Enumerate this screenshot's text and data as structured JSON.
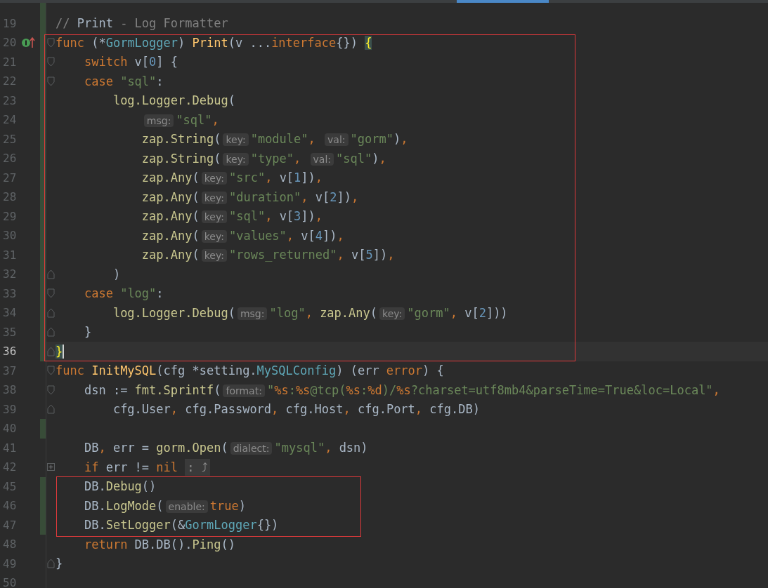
{
  "editor": {
    "lines": [
      {
        "changed": true
      },
      {
        "number": "19",
        "changed": true,
        "tokens": [
          {
            "kind": "comment",
            "text": "// "
          },
          {
            "kind": "comment_word",
            "text": "Print"
          },
          {
            "kind": "comment",
            "text": " - Log Formatter"
          }
        ]
      },
      {
        "number": "20",
        "changed": true,
        "boxed": true,
        "marker": true,
        "fold_start": true,
        "tokens": [
          {
            "kind": "keyword",
            "text": "func"
          },
          {
            "kind": "plain",
            "text": " (*"
          },
          {
            "kind": "type",
            "text": "GormLogger"
          },
          {
            "kind": "plain",
            "text": ") "
          },
          {
            "kind": "decl",
            "text": "Print"
          },
          {
            "kind": "plain",
            "text": "(v ..."
          },
          {
            "kind": "keyword",
            "text": "interface"
          },
          {
            "kind": "plain",
            "text": "{}) "
          },
          {
            "kind": "brace",
            "text": "{"
          }
        ]
      },
      {
        "number": "21",
        "changed": true,
        "boxed": true,
        "fold_start": true,
        "tokens": [
          {
            "kind": "keyword",
            "text": "    switch"
          },
          {
            "kind": "plain",
            "text": " v["
          },
          {
            "kind": "number",
            "text": "0"
          },
          {
            "kind": "plain",
            "text": "] {"
          }
        ]
      },
      {
        "number": "22",
        "changed": true,
        "boxed": true,
        "fold_start": true,
        "tokens": [
          {
            "kind": "keyword",
            "text": "    case"
          },
          {
            "kind": "string",
            "text": " \"sql\""
          },
          {
            "kind": "plain",
            "text": ":"
          }
        ]
      },
      {
        "number": "23",
        "changed": true,
        "boxed": true,
        "tokens": [
          {
            "kind": "call",
            "text": "        log.Logger.Debug"
          },
          {
            "kind": "plain",
            "text": "("
          }
        ]
      },
      {
        "number": "24",
        "changed": true,
        "boxed": true,
        "tokens": [
          {
            "kind": "hint",
            "text": "            msg:"
          },
          {
            "kind": "string",
            "text": "\"sql\""
          },
          {
            "kind": "keyword",
            "text": ","
          }
        ]
      },
      {
        "number": "25",
        "changed": true,
        "boxed": true,
        "tokens": [
          {
            "kind": "call",
            "text": "            zap.String"
          },
          {
            "kind": "plain",
            "text": "("
          },
          {
            "kind": "hint",
            "text": "key:"
          },
          {
            "kind": "string",
            "text": "\"module\""
          },
          {
            "kind": "keyword",
            "text": ", "
          },
          {
            "kind": "hint",
            "text": "val:"
          },
          {
            "kind": "string",
            "text": "\"gorm\""
          },
          {
            "kind": "plain",
            "text": ")"
          },
          {
            "kind": "keyword",
            "text": ","
          }
        ]
      },
      {
        "number": "26",
        "changed": true,
        "boxed": true,
        "tokens": [
          {
            "kind": "call",
            "text": "            zap.String"
          },
          {
            "kind": "plain",
            "text": "("
          },
          {
            "kind": "hint",
            "text": "key:"
          },
          {
            "kind": "string",
            "text": "\"type\""
          },
          {
            "kind": "keyword",
            "text": ", "
          },
          {
            "kind": "hint",
            "text": "val:"
          },
          {
            "kind": "string",
            "text": "\"sql\""
          },
          {
            "kind": "plain",
            "text": ")"
          },
          {
            "kind": "keyword",
            "text": ","
          }
        ]
      },
      {
        "number": "27",
        "changed": true,
        "boxed": true,
        "tokens": [
          {
            "kind": "call",
            "text": "            zap.Any"
          },
          {
            "kind": "plain",
            "text": "("
          },
          {
            "kind": "hint",
            "text": "key:"
          },
          {
            "kind": "string",
            "text": "\"src\""
          },
          {
            "kind": "keyword",
            "text": ","
          },
          {
            "kind": "plain",
            "text": " v["
          },
          {
            "kind": "number",
            "text": "1"
          },
          {
            "kind": "plain",
            "text": "])"
          },
          {
            "kind": "keyword",
            "text": ","
          }
        ]
      },
      {
        "number": "28",
        "changed": true,
        "boxed": true,
        "tokens": [
          {
            "kind": "call",
            "text": "            zap.Any"
          },
          {
            "kind": "plain",
            "text": "("
          },
          {
            "kind": "hint",
            "text": "key:"
          },
          {
            "kind": "string",
            "text": "\"duration\""
          },
          {
            "kind": "keyword",
            "text": ","
          },
          {
            "kind": "plain",
            "text": " v["
          },
          {
            "kind": "number",
            "text": "2"
          },
          {
            "kind": "plain",
            "text": "])"
          },
          {
            "kind": "keyword",
            "text": ","
          }
        ]
      },
      {
        "number": "29",
        "changed": true,
        "boxed": true,
        "tokens": [
          {
            "kind": "call",
            "text": "            zap.Any"
          },
          {
            "kind": "plain",
            "text": "("
          },
          {
            "kind": "hint",
            "text": "key:"
          },
          {
            "kind": "string",
            "text": "\"sql\""
          },
          {
            "kind": "keyword",
            "text": ","
          },
          {
            "kind": "plain",
            "text": " v["
          },
          {
            "kind": "number",
            "text": "3"
          },
          {
            "kind": "plain",
            "text": "])"
          },
          {
            "kind": "keyword",
            "text": ","
          }
        ]
      },
      {
        "number": "30",
        "changed": true,
        "boxed": true,
        "tokens": [
          {
            "kind": "call",
            "text": "            zap.Any"
          },
          {
            "kind": "plain",
            "text": "("
          },
          {
            "kind": "hint",
            "text": "key:"
          },
          {
            "kind": "string",
            "text": "\"values\""
          },
          {
            "kind": "keyword",
            "text": ","
          },
          {
            "kind": "plain",
            "text": " v["
          },
          {
            "kind": "number",
            "text": "4"
          },
          {
            "kind": "plain",
            "text": "])"
          },
          {
            "kind": "keyword",
            "text": ","
          }
        ]
      },
      {
        "number": "31",
        "changed": true,
        "boxed": true,
        "tokens": [
          {
            "kind": "call",
            "text": "            zap.Any"
          },
          {
            "kind": "plain",
            "text": "("
          },
          {
            "kind": "hint",
            "text": "key:"
          },
          {
            "kind": "string",
            "text": "\"rows_returned\""
          },
          {
            "kind": "keyword",
            "text": ","
          },
          {
            "kind": "plain",
            "text": " v["
          },
          {
            "kind": "number",
            "text": "5"
          },
          {
            "kind": "plain",
            "text": "])"
          },
          {
            "kind": "keyword",
            "text": ","
          }
        ]
      },
      {
        "number": "32",
        "changed": true,
        "boxed": true,
        "fold_end": true,
        "tokens": [
          {
            "kind": "plain",
            "text": "        )"
          }
        ]
      },
      {
        "number": "33",
        "changed": true,
        "boxed": true,
        "fold_start": true,
        "tokens": [
          {
            "kind": "keyword",
            "text": "    case"
          },
          {
            "kind": "string",
            "text": " \"log\""
          },
          {
            "kind": "plain",
            "text": ":"
          }
        ]
      },
      {
        "number": "34",
        "changed": true,
        "boxed": true,
        "fold_end": true,
        "tokens": [
          {
            "kind": "call",
            "text": "        log.Logger.Debug"
          },
          {
            "kind": "plain",
            "text": "("
          },
          {
            "kind": "hint",
            "text": "msg:"
          },
          {
            "kind": "string",
            "text": "\"log\""
          },
          {
            "kind": "keyword",
            "text": ","
          },
          {
            "kind": "call",
            "text": " zap.Any"
          },
          {
            "kind": "plain",
            "text": "("
          },
          {
            "kind": "hint",
            "text": "key:"
          },
          {
            "kind": "string",
            "text": "\"gorm\""
          },
          {
            "kind": "keyword",
            "text": ","
          },
          {
            "kind": "plain",
            "text": " v["
          },
          {
            "kind": "number",
            "text": "2"
          },
          {
            "kind": "plain",
            "text": "]))"
          }
        ]
      },
      {
        "number": "35",
        "changed": true,
        "boxed": true,
        "fold_end": true,
        "tokens": [
          {
            "kind": "plain",
            "text": "    }"
          }
        ]
      },
      {
        "number": "36",
        "changed": true,
        "boxed": true,
        "current": true,
        "caret": true,
        "fold_end": true,
        "tokens": [
          {
            "kind": "brace",
            "text": "}"
          }
        ]
      },
      {
        "number": "37",
        "fold_start": true,
        "tokens": [
          {
            "kind": "keyword",
            "text": "func"
          },
          {
            "kind": "decl",
            "text": " InitMySQL"
          },
          {
            "kind": "plain",
            "text": "(cfg *setting."
          },
          {
            "kind": "type",
            "text": "MySQLConfig"
          },
          {
            "kind": "plain",
            "text": ") (err "
          },
          {
            "kind": "keyword",
            "text": "error"
          },
          {
            "kind": "plain",
            "text": ") {"
          }
        ]
      },
      {
        "number": "38",
        "fold_start": true,
        "tokens": [
          {
            "kind": "plain",
            "text": "    dsn := "
          },
          {
            "kind": "call",
            "text": "fmt.Sprintf"
          },
          {
            "kind": "plain",
            "text": "("
          },
          {
            "kind": "hint",
            "text": "format:"
          },
          {
            "kind": "string",
            "text": "\""
          },
          {
            "kind": "verb",
            "text": "%s"
          },
          {
            "kind": "string",
            "text": ":"
          },
          {
            "kind": "verb",
            "text": "%s"
          },
          {
            "kind": "string",
            "text": "@tcp("
          },
          {
            "kind": "verb",
            "text": "%s"
          },
          {
            "kind": "string",
            "text": ":"
          },
          {
            "kind": "verb",
            "text": "%d"
          },
          {
            "kind": "string",
            "text": ")/"
          },
          {
            "kind": "verb",
            "text": "%s"
          },
          {
            "kind": "string",
            "text": "?charset=utf8mb4&parseTime=True&loc=Local\""
          },
          {
            "kind": "keyword",
            "text": ","
          }
        ]
      },
      {
        "number": "39",
        "fold_end": true,
        "tokens": [
          {
            "kind": "plain",
            "text": "        cfg.User"
          },
          {
            "kind": "keyword",
            "text": ","
          },
          {
            "kind": "plain",
            "text": " cfg.Password"
          },
          {
            "kind": "keyword",
            "text": ","
          },
          {
            "kind": "plain",
            "text": " cfg.Host"
          },
          {
            "kind": "keyword",
            "text": ","
          },
          {
            "kind": "plain",
            "text": " cfg.Port"
          },
          {
            "kind": "keyword",
            "text": ","
          },
          {
            "kind": "plain",
            "text": " cfg.DB)"
          }
        ]
      },
      {
        "number": "40",
        "changed": true
      },
      {
        "number": "41",
        "tokens": [
          {
            "kind": "plain",
            "text": "    DB"
          },
          {
            "kind": "keyword",
            "text": ","
          },
          {
            "kind": "plain",
            "text": " err = "
          },
          {
            "kind": "call",
            "text": "gorm.Open"
          },
          {
            "kind": "plain",
            "text": "("
          },
          {
            "kind": "hint",
            "text": "dialect:"
          },
          {
            "kind": "string",
            "text": "\"mysql\""
          },
          {
            "kind": "keyword",
            "text": ","
          },
          {
            "kind": "plain",
            "text": " dsn)"
          }
        ]
      },
      {
        "number": "42",
        "collapsed": true,
        "tokens": [
          {
            "kind": "keyword",
            "text": "    if"
          },
          {
            "kind": "plain",
            "text": " err != "
          },
          {
            "kind": "keyword",
            "text": "nil"
          },
          {
            "kind": "folded",
            "text": " : ⤴"
          }
        ]
      },
      {
        "number": "45",
        "changed": true,
        "framed": true,
        "tokens": [
          {
            "kind": "plain",
            "text": "    DB."
          },
          {
            "kind": "call",
            "text": "Debug"
          },
          {
            "kind": "plain",
            "text": "()"
          }
        ]
      },
      {
        "number": "46",
        "changed": true,
        "framed": true,
        "tokens": [
          {
            "kind": "plain",
            "text": "    DB."
          },
          {
            "kind": "call",
            "text": "LogMode"
          },
          {
            "kind": "plain",
            "text": "("
          },
          {
            "kind": "hint",
            "text": "enable:"
          },
          {
            "kind": "keyword",
            "text": "true"
          },
          {
            "kind": "plain",
            "text": ")"
          }
        ]
      },
      {
        "number": "47",
        "changed": true,
        "framed": true,
        "tokens": [
          {
            "kind": "plain",
            "text": "    DB."
          },
          {
            "kind": "call",
            "text": "SetLogger"
          },
          {
            "kind": "plain",
            "text": "(&"
          },
          {
            "kind": "type",
            "text": "GormLogger"
          },
          {
            "kind": "plain",
            "text": "{})"
          }
        ]
      },
      {
        "number": "48",
        "tokens": [
          {
            "kind": "keyword",
            "text": "    return"
          },
          {
            "kind": "plain",
            "text": " DB.DB()."
          },
          {
            "kind": "call",
            "text": "Ping"
          },
          {
            "kind": "plain",
            "text": "()"
          }
        ]
      },
      {
        "number": "49",
        "fold_end": true,
        "tokens": [
          {
            "kind": "plain",
            "text": "}"
          }
        ]
      },
      {
        "number": "50"
      }
    ]
  }
}
